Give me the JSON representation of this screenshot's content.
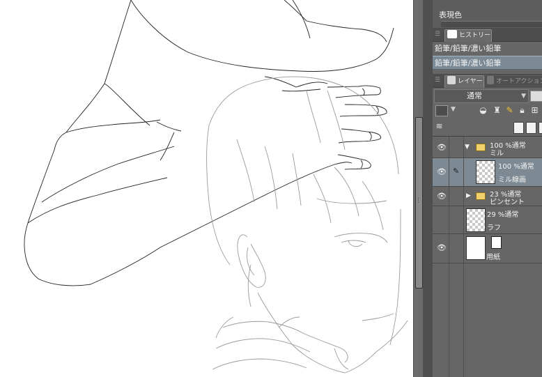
{
  "colors": {
    "panel_bg": "#666666",
    "selected_row": "#7d8a93",
    "canvas_bg": "#ffffff"
  },
  "expression": {
    "label": "表現色"
  },
  "history": {
    "tab_label": "ヒストリー",
    "tab_icon": "history-icon",
    "items": [
      {
        "label": "鉛筆/鉛筆/濃い鉛筆",
        "selected": false
      },
      {
        "label": "鉛筆/鉛筆/濃い鉛筆",
        "selected": true
      }
    ]
  },
  "layers": {
    "tab_label": "レイヤー",
    "tab2_label": "オートアクション",
    "blend_mode": "通常",
    "items": [
      {
        "type": "folder",
        "expanded": true,
        "opacity": "100 %通常",
        "name": "ミル",
        "visible": true,
        "selected": false
      },
      {
        "type": "raster",
        "opacity": "100 %通常",
        "name": "ミル線画",
        "visible": true,
        "selected": true,
        "editing": true
      },
      {
        "type": "folder",
        "expanded": false,
        "opacity": "23 %通常",
        "name": "ピンセント",
        "visible": true,
        "selected": false
      },
      {
        "type": "raster",
        "opacity": "29 %通常",
        "name": "ラフ",
        "visible": false,
        "selected": false
      },
      {
        "type": "paper",
        "name": "用紙",
        "visible": true,
        "selected": false
      }
    ]
  }
}
